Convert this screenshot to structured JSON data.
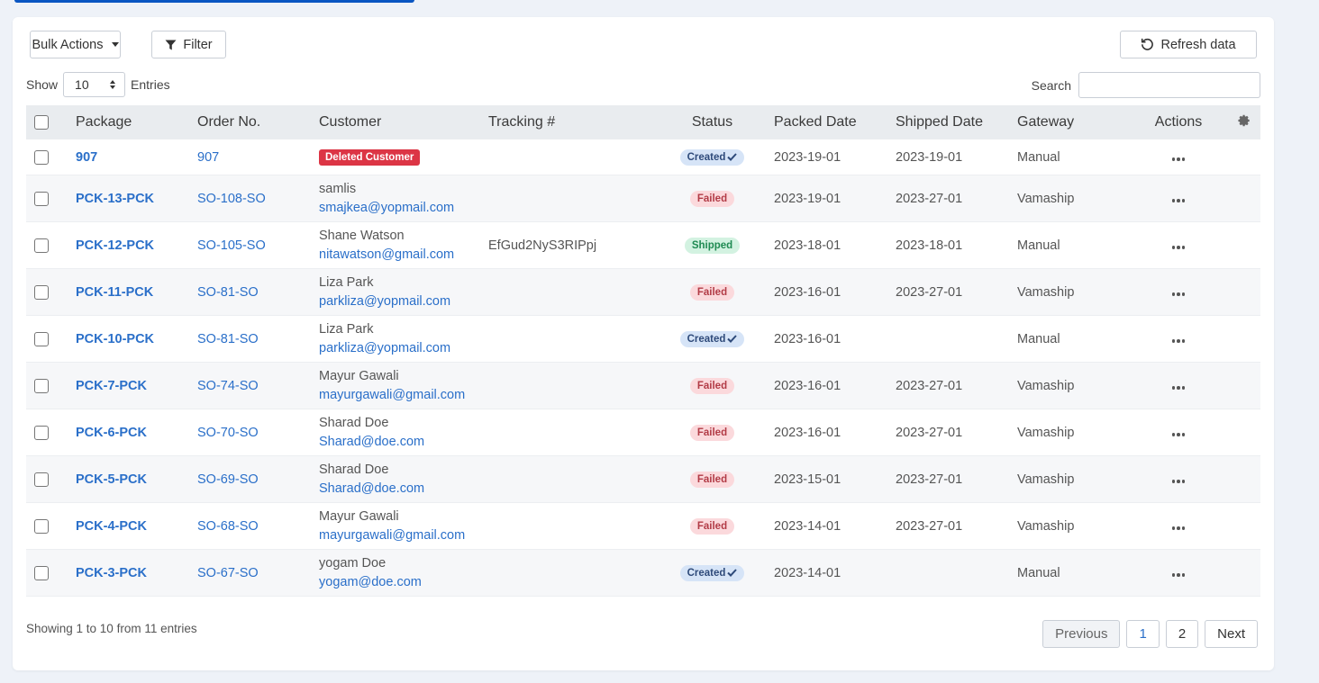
{
  "toolbar": {
    "bulk_actions_label": "Bulk Actions",
    "filter_label": "Filter",
    "refresh_label": "Refresh data"
  },
  "length": {
    "show_label": "Show",
    "value": "10",
    "entries_label": "Entries"
  },
  "search": {
    "label": "Search",
    "value": ""
  },
  "columns": [
    "Package",
    "Order No.",
    "Customer",
    "Tracking #",
    "Status",
    "Packed Date",
    "Shipped Date",
    "Gateway",
    "Actions"
  ],
  "rows": [
    {
      "package": "907",
      "order": "907",
      "customer_name": "",
      "customer_email": "",
      "customer_badge": "Deleted Customer",
      "tracking": "",
      "status": "Created",
      "status_type": "created",
      "packed": "2023-19-01",
      "shipped": "2023-19-01",
      "gateway": "Manual"
    },
    {
      "package": "PCK-13-PCK",
      "order": "SO-108-SO",
      "customer_name": "samlis",
      "customer_email": "smajkea@yopmail.com",
      "customer_badge": "",
      "tracking": "",
      "status": "Failed",
      "status_type": "failed",
      "packed": "2023-19-01",
      "shipped": "2023-27-01",
      "gateway": "Vamaship"
    },
    {
      "package": "PCK-12-PCK",
      "order": "SO-105-SO",
      "customer_name": "Shane Watson",
      "customer_email": "nitawatson@gmail.com",
      "customer_badge": "",
      "tracking": "EfGud2NyS3RIPpj",
      "status": "Shipped",
      "status_type": "shipped",
      "packed": "2023-18-01",
      "shipped": "2023-18-01",
      "gateway": "Manual"
    },
    {
      "package": "PCK-11-PCK",
      "order": "SO-81-SO",
      "customer_name": "Liza Park",
      "customer_email": "parkliza@yopmail.com",
      "customer_badge": "",
      "tracking": "",
      "status": "Failed",
      "status_type": "failed",
      "packed": "2023-16-01",
      "shipped": "2023-27-01",
      "gateway": "Vamaship"
    },
    {
      "package": "PCK-10-PCK",
      "order": "SO-81-SO",
      "customer_name": "Liza Park",
      "customer_email": "parkliza@yopmail.com",
      "customer_badge": "",
      "tracking": "",
      "status": "Created",
      "status_type": "created",
      "packed": "2023-16-01",
      "shipped": "",
      "gateway": "Manual"
    },
    {
      "package": "PCK-7-PCK",
      "order": "SO-74-SO",
      "customer_name": "Mayur Gawali",
      "customer_email": "mayurgawali@gmail.com",
      "customer_badge": "",
      "tracking": "",
      "status": "Failed",
      "status_type": "failed",
      "packed": "2023-16-01",
      "shipped": "2023-27-01",
      "gateway": "Vamaship"
    },
    {
      "package": "PCK-6-PCK",
      "order": "SO-70-SO",
      "customer_name": "Sharad Doe",
      "customer_email": "Sharad@doe.com",
      "customer_badge": "",
      "tracking": "",
      "status": "Failed",
      "status_type": "failed",
      "packed": "2023-16-01",
      "shipped": "2023-27-01",
      "gateway": "Vamaship"
    },
    {
      "package": "PCK-5-PCK",
      "order": "SO-69-SO",
      "customer_name": "Sharad Doe",
      "customer_email": "Sharad@doe.com",
      "customer_badge": "",
      "tracking": "",
      "status": "Failed",
      "status_type": "failed",
      "packed": "2023-15-01",
      "shipped": "2023-27-01",
      "gateway": "Vamaship"
    },
    {
      "package": "PCK-4-PCK",
      "order": "SO-68-SO",
      "customer_name": "Mayur Gawali",
      "customer_email": "mayurgawali@gmail.com",
      "customer_badge": "",
      "tracking": "",
      "status": "Failed",
      "status_type": "failed",
      "packed": "2023-14-01",
      "shipped": "2023-27-01",
      "gateway": "Vamaship"
    },
    {
      "package": "PCK-3-PCK",
      "order": "SO-67-SO",
      "customer_name": "yogam Doe",
      "customer_email": "yogam@doe.com",
      "customer_badge": "",
      "tracking": "",
      "status": "Created",
      "status_type": "created",
      "packed": "2023-14-01",
      "shipped": "",
      "gateway": "Manual"
    }
  ],
  "footer": {
    "info": "Showing 1 to 10 from 11 entries"
  },
  "pagination": {
    "previous": "Previous",
    "pages": [
      "1",
      "2"
    ],
    "next": "Next"
  },
  "icons": {
    "filter": "filter-icon",
    "refresh": "refresh-icon",
    "settings": "gear-icon",
    "actions": "more-horizontal-icon",
    "created_check": "check-icon"
  },
  "colors": {
    "link": "#2a6fc9",
    "created": "#d6e4f7",
    "failed": "#fbd9dc",
    "shipped": "#d3f2e1",
    "deleted": "#dc3545",
    "accent_strip": "#0a56c2"
  }
}
